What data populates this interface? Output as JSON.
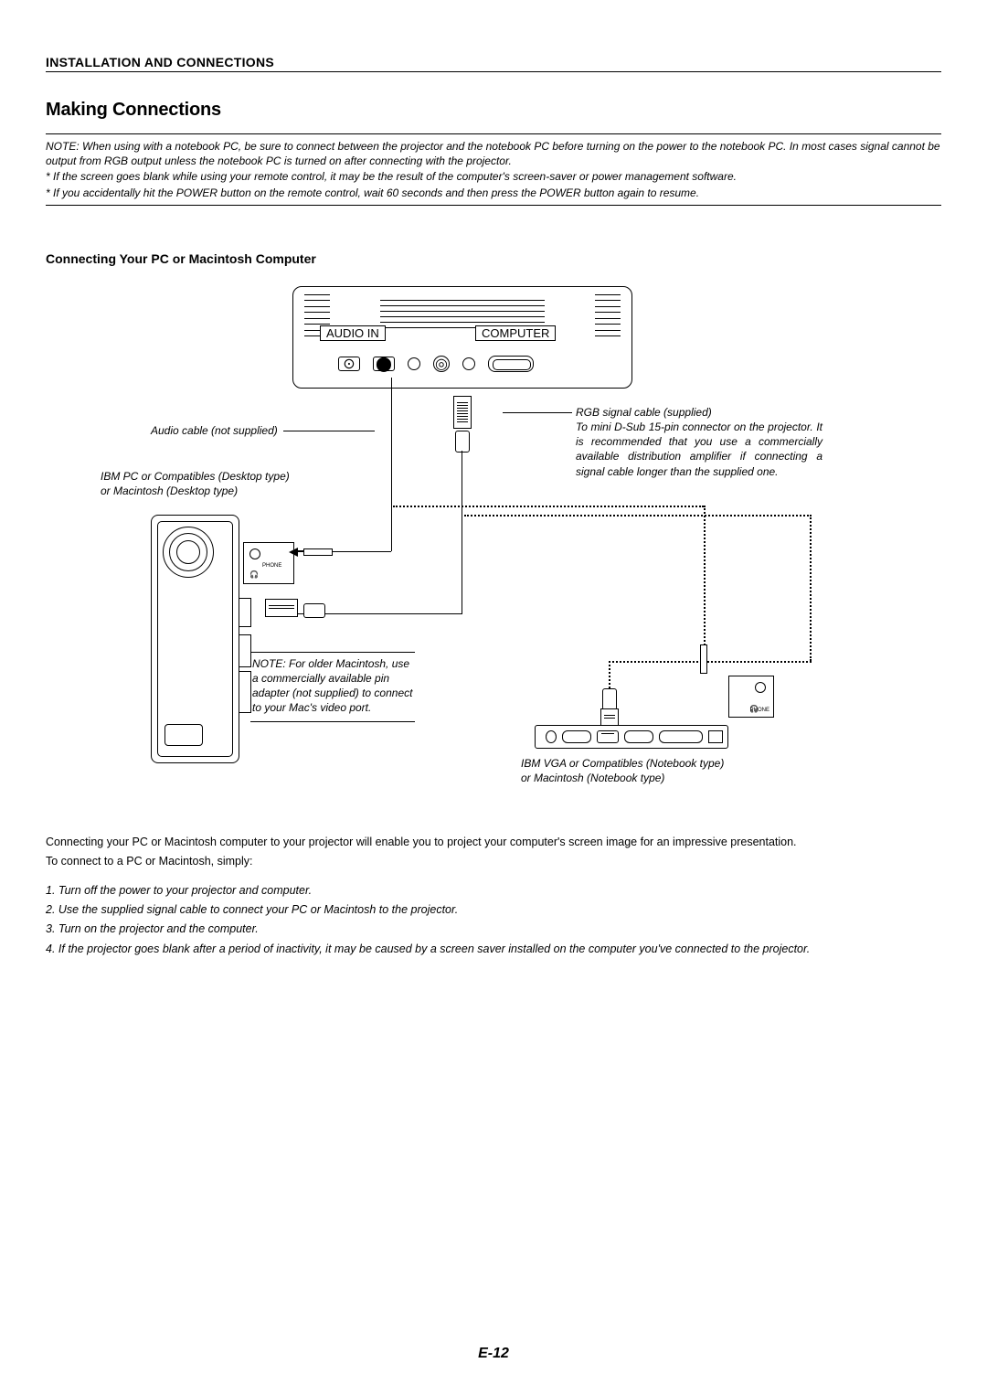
{
  "header": {
    "running_head": "INSTALLATION AND CONNECTIONS"
  },
  "title": "Making Connections",
  "note_block": {
    "label": "NOTE:",
    "text": "When using with a notebook PC, be sure to connect between the projector and the notebook PC before turning on the power to the notebook PC. In most cases signal cannot be output from RGB output unless the notebook PC is turned on after connecting with the projector.",
    "bullet1": "* If the screen goes blank while using your remote control, it may be the result of the computer's screen-saver or power management software.",
    "bullet2": "* If you accidentally hit the POWER button on the remote control, wait 60 seconds and then press the POWER button again to resume."
  },
  "subheading": "Connecting Your PC or Macintosh Computer",
  "diagram": {
    "port_audio": "AUDIO IN",
    "port_computer": "COMPUTER",
    "phone_label": "PHONE",
    "audio_cable_label": "Audio cable (not supplied)",
    "desktop_label_l1": "IBM PC or Compatibles (Desktop type)",
    "desktop_label_l2": "or Macintosh (Desktop type)",
    "rgb_label_l1": "RGB signal cable (supplied)",
    "rgb_label_l2": "To mini D-Sub 15-pin connector on the projector. It is recommended that you use a commercially available distribution amplifier if connecting a signal cable longer than the supplied one.",
    "mac_note_label": "NOTE:",
    "mac_note_text": "For older Macintosh, use a commercially available pin adapter (not supplied) to connect to your Mac's video port.",
    "notebook_label_l1": "IBM VGA or Compatibles (Notebook type)",
    "notebook_label_l2": "or Macintosh (Notebook type)"
  },
  "body": {
    "p1": "Connecting your PC or Macintosh computer to your projector will enable you to project your computer's screen image for an impressive presentation.",
    "p2": "To connect to a PC or Macintosh, simply:",
    "steps": {
      "s1": "1. Turn off the power to your projector and computer.",
      "s2": "2. Use the supplied signal cable to connect your PC or Macintosh to the projector.",
      "s3": "3. Turn on the projector and the computer.",
      "s4": "4. If the projector goes blank after a period of inactivity, it may be caused by a screen saver installed on the computer you've connected to the projector."
    }
  },
  "page_number": "E-12"
}
